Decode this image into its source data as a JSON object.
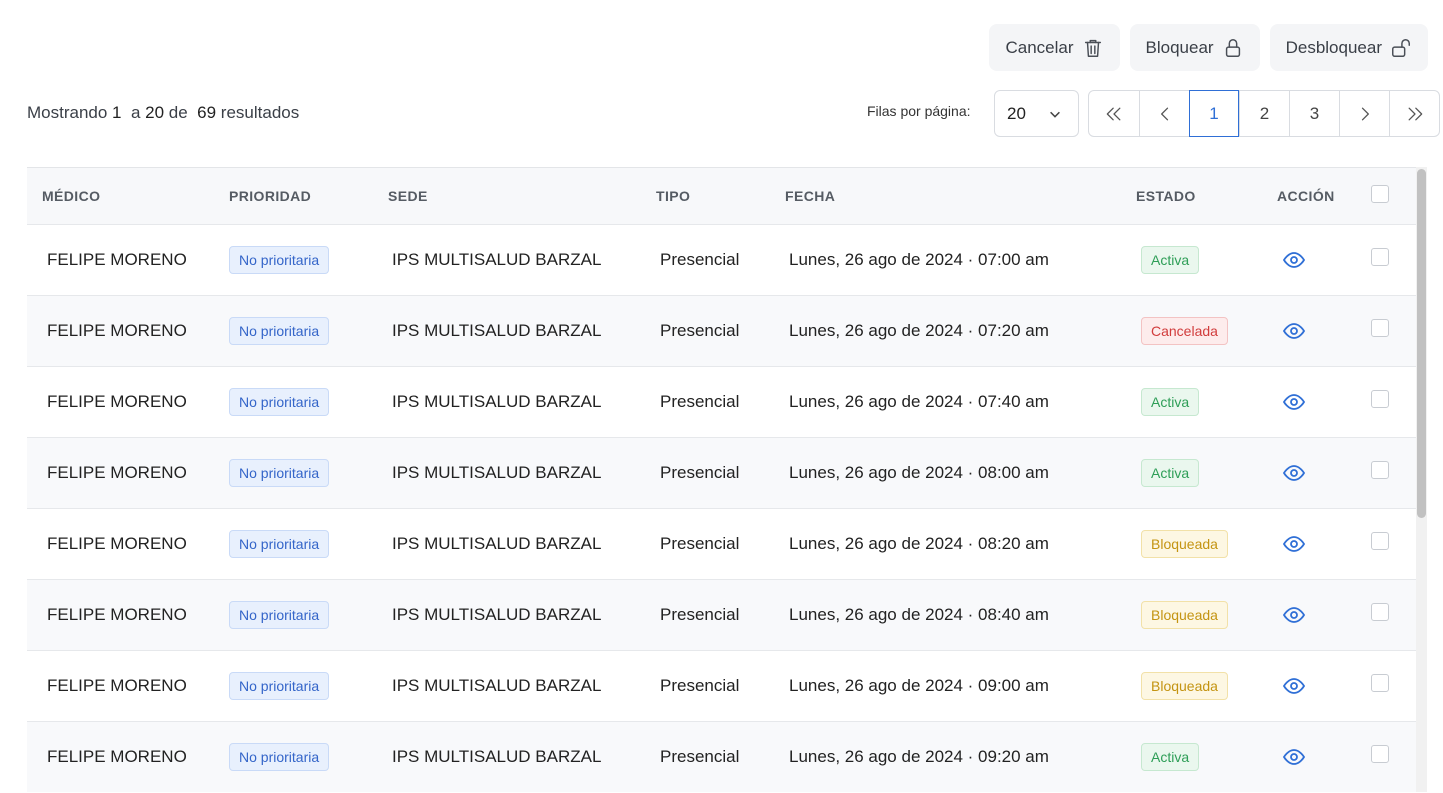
{
  "actions": {
    "cancel_label": "Cancelar",
    "block_label": "Bloquear",
    "unblock_label": "Desbloquear"
  },
  "summary": {
    "prefix": "Mostrando ",
    "from": "1",
    "to_word": "  a ",
    "to": "20",
    "of_word": " de  ",
    "total": "69",
    "suffix": " resultados"
  },
  "rows_per_page": {
    "label": "Filas por página:",
    "value": "20"
  },
  "pagination": {
    "pages": [
      "1",
      "2",
      "3"
    ],
    "current": "1"
  },
  "table": {
    "headers": {
      "medico": "MÉDICO",
      "prioridad": "PRIORIDAD",
      "sede": "SEDE",
      "tipo": "TIPO",
      "fecha": "FECHA",
      "estado": "ESTADO",
      "accion": "ACCIÓN"
    },
    "rows": [
      {
        "medico": "FELIPE MORENO",
        "prioridad": "No prioritaria",
        "sede": "IPS MULTISALUD BARZAL",
        "tipo": "Presencial",
        "fecha": "Lunes, 26 ago de 2024 · 07:00 am",
        "estado": "Activa"
      },
      {
        "medico": "FELIPE MORENO",
        "prioridad": "No prioritaria",
        "sede": "IPS MULTISALUD BARZAL",
        "tipo": "Presencial",
        "fecha": "Lunes, 26 ago de 2024 · 07:20 am",
        "estado": "Cancelada"
      },
      {
        "medico": "FELIPE MORENO",
        "prioridad": "No prioritaria",
        "sede": "IPS MULTISALUD BARZAL",
        "tipo": "Presencial",
        "fecha": "Lunes, 26 ago de 2024 · 07:40 am",
        "estado": "Activa"
      },
      {
        "medico": "FELIPE MORENO",
        "prioridad": "No prioritaria",
        "sede": "IPS MULTISALUD BARZAL",
        "tipo": "Presencial",
        "fecha": "Lunes, 26 ago de 2024 · 08:00 am",
        "estado": "Activa"
      },
      {
        "medico": "FELIPE MORENO",
        "prioridad": "No prioritaria",
        "sede": "IPS MULTISALUD BARZAL",
        "tipo": "Presencial",
        "fecha": "Lunes, 26 ago de 2024 · 08:20 am",
        "estado": "Bloqueada"
      },
      {
        "medico": "FELIPE MORENO",
        "prioridad": "No prioritaria",
        "sede": "IPS MULTISALUD BARZAL",
        "tipo": "Presencial",
        "fecha": "Lunes, 26 ago de 2024 · 08:40 am",
        "estado": "Bloqueada"
      },
      {
        "medico": "FELIPE MORENO",
        "prioridad": "No prioritaria",
        "sede": "IPS MULTISALUD BARZAL",
        "tipo": "Presencial",
        "fecha": "Lunes, 26 ago de 2024 · 09:00 am",
        "estado": "Bloqueada"
      },
      {
        "medico": "FELIPE MORENO",
        "prioridad": "No prioritaria",
        "sede": "IPS MULTISALUD BARZAL",
        "tipo": "Presencial",
        "fecha": "Lunes, 26 ago de 2024 · 09:20 am",
        "estado": "Activa"
      }
    ]
  },
  "colors": {
    "accent": "#2f6fd6",
    "status_active": "#2e9e57",
    "status_cancelled": "#d13c3c",
    "status_blocked": "#c49412"
  },
  "icons": {
    "cancel": "trash-icon",
    "block": "lock-icon",
    "unblock": "unlock-icon",
    "view": "eye-icon"
  }
}
